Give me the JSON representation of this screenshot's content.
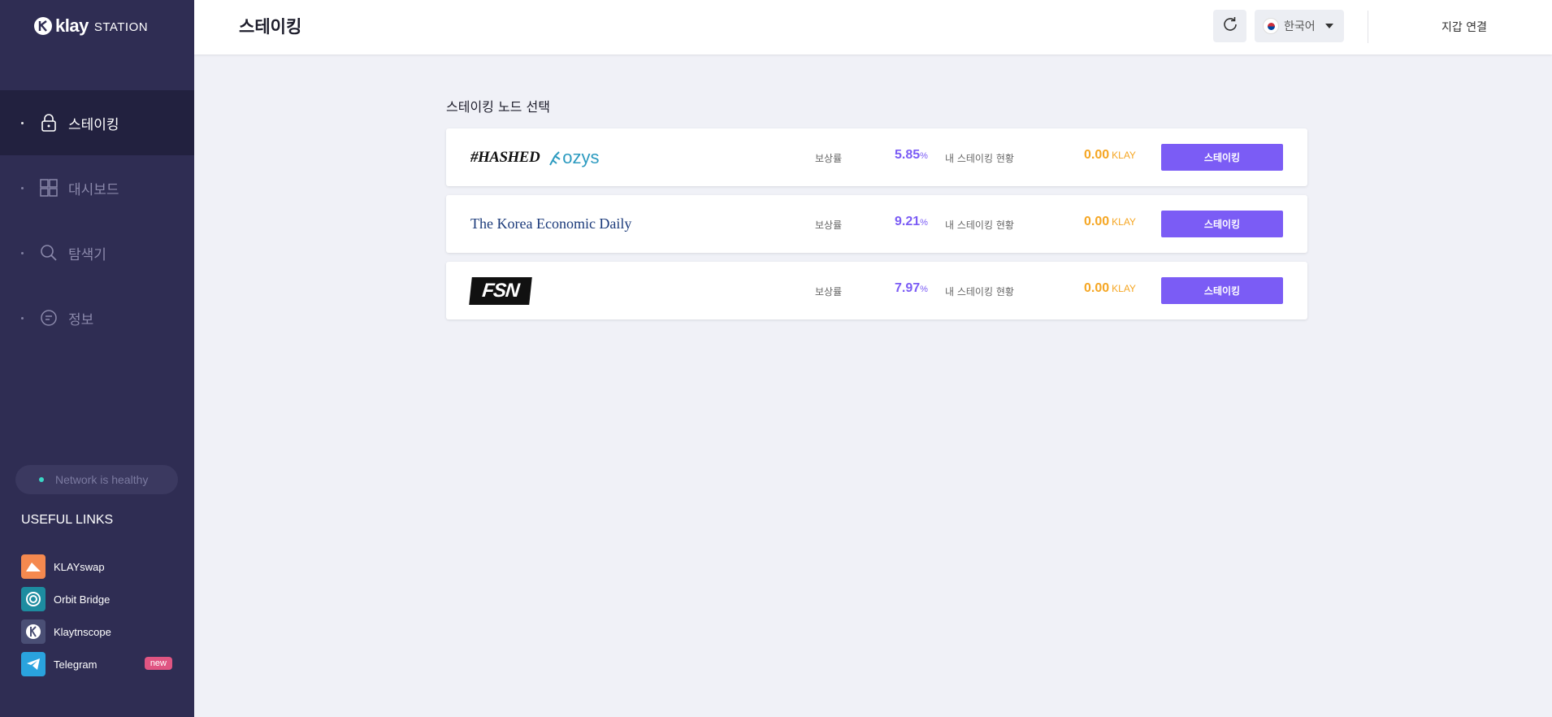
{
  "brand": {
    "name": "klay",
    "sub": "STATION"
  },
  "header": {
    "title": "스테이킹",
    "language": "한국어",
    "wallet_label": "지갑 연결"
  },
  "nav": [
    {
      "label": "스테이킹",
      "icon": "lock-icon",
      "active": true
    },
    {
      "label": "대시보드",
      "icon": "dashboard-icon",
      "active": false
    },
    {
      "label": "탐색기",
      "icon": "search-icon",
      "active": false
    },
    {
      "label": "정보",
      "icon": "info-chat-icon",
      "active": false
    }
  ],
  "network_status": "Network is healthy",
  "useful_links": {
    "title": "USEFUL LINKS",
    "items": [
      {
        "label": "KLAYswap",
        "icon": "klayswap-icon",
        "color": "#f5894f"
      },
      {
        "label": "Orbit Bridge",
        "icon": "orbit-bridge-icon",
        "color": "#1d8ca0"
      },
      {
        "label": "Klaytnscope",
        "icon": "klaytnscope-icon",
        "color": "#4a4f75"
      },
      {
        "label": "Telegram",
        "icon": "telegram-icon",
        "color": "#2aa3de",
        "badge": "new"
      }
    ]
  },
  "main": {
    "section_title": "스테이킹 노드 선택",
    "nodes": [
      {
        "logo": "hashed-ozys",
        "logo_text_1": "#HASHED",
        "logo_text_2": "ozys",
        "rate_label": "보상률",
        "rate": "5.85",
        "rate_unit": "%",
        "my_label": "내 스테이킹 현황",
        "my_amount": "0.00",
        "my_unit": "KLAY",
        "button": "스테이킹"
      },
      {
        "logo": "korea-economic-daily",
        "logo_text_1": "The Korea Economic Daily",
        "rate_label": "보상률",
        "rate": "9.21",
        "rate_unit": "%",
        "my_label": "내 스테이킹 현황",
        "my_amount": "0.00",
        "my_unit": "KLAY",
        "button": "스테이킹"
      },
      {
        "logo": "fsn",
        "logo_text_1": "FSN",
        "rate_label": "보상률",
        "rate": "7.97",
        "rate_unit": "%",
        "my_label": "내 스테이킹 현황",
        "my_amount": "0.00",
        "my_unit": "KLAY",
        "button": "스테이킹"
      }
    ]
  },
  "colors": {
    "sidebar": "#2f2d53",
    "accent": "#7b5cf5",
    "amount": "#f5a623"
  }
}
